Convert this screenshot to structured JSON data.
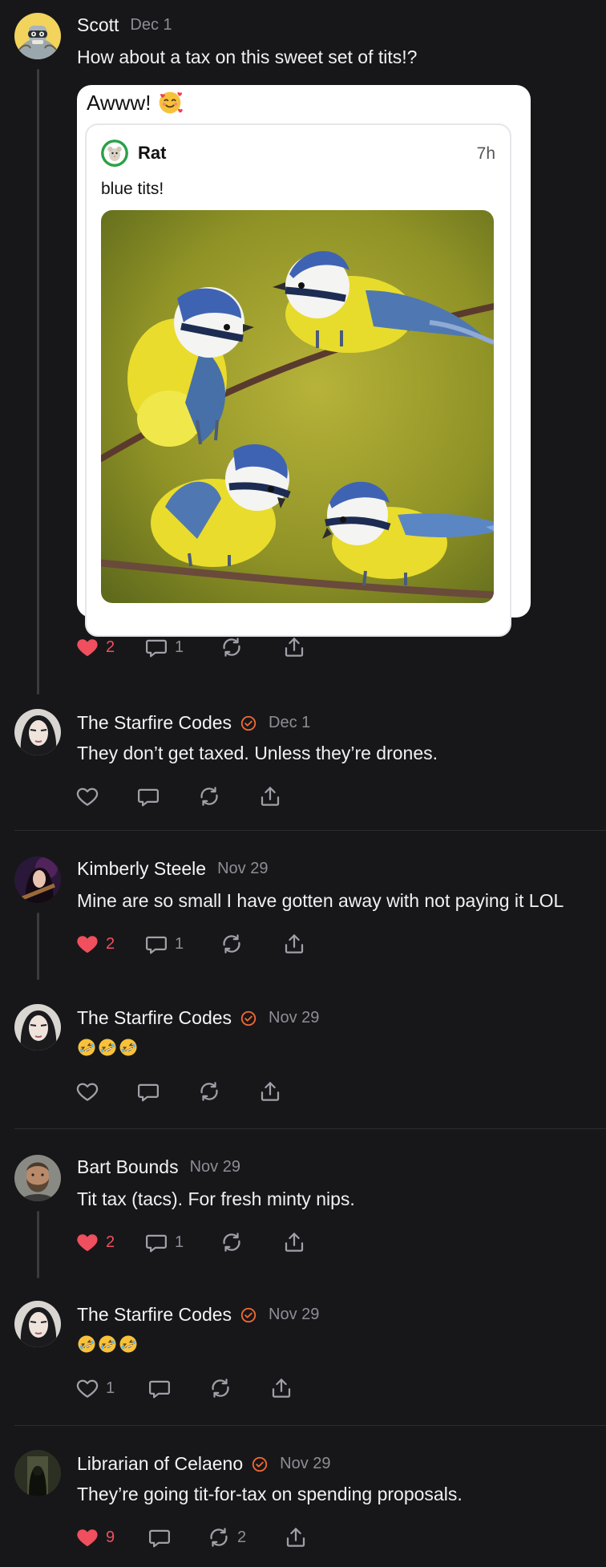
{
  "posts": [
    {
      "author": "Scott",
      "date": "Dec 1",
      "text": "How about a tax on this sweet set of tits!?",
      "likes": "2",
      "replies": "1",
      "reposts": "",
      "liked": true,
      "quote": {
        "comment": "Awww!",
        "emoji": "smiling-face-with-hearts",
        "author": "Rat",
        "time": "7h",
        "text": "blue tits!"
      }
    },
    {
      "author": "The Starfire Codes",
      "verified": true,
      "date": "Dec 1",
      "text": "They don’t get taxed. Unless they’re drones.",
      "likes": "",
      "replies": "",
      "reposts": "",
      "liked": false
    },
    {
      "author": "Kimberly Steele",
      "date": "Nov 29",
      "text": "Mine are so small I have gotten away with not paying it LOL",
      "likes": "2",
      "replies": "1",
      "reposts": "",
      "liked": true
    },
    {
      "author": "The Starfire Codes",
      "verified": true,
      "date": "Nov 29",
      "text": "",
      "emoji": "rolling-on-floor-laughing x3",
      "likes": "",
      "replies": "",
      "reposts": "",
      "liked": false
    },
    {
      "author": "Bart Bounds",
      "date": "Nov 29",
      "text": "Tit tax (tacs). For fresh minty nips.",
      "likes": "2",
      "replies": "1",
      "reposts": "",
      "liked": true
    },
    {
      "author": "The Starfire Codes",
      "verified": true,
      "date": "Nov 29",
      "text": "",
      "emoji": "rolling-on-floor-laughing x3",
      "likes": "1",
      "replies": "",
      "reposts": "",
      "liked": false
    },
    {
      "author": "Librarian of Celaeno",
      "verified": true,
      "date": "Nov 29",
      "text": "They’re going tit-for-tax on spending proposals.",
      "likes": "9",
      "replies": "",
      "reposts": "2",
      "liked": true
    }
  ],
  "icons": {
    "like": "heart-icon",
    "reply": "comment-bubble-icon",
    "repost": "repost-arrows-icon",
    "share": "share-upload-icon",
    "verified": "verified-check-badge-icon"
  },
  "colors": {
    "background": "#17171a",
    "liked": "#f04f5e",
    "verified": "#ef6a32",
    "muted": "#8d8d95"
  }
}
